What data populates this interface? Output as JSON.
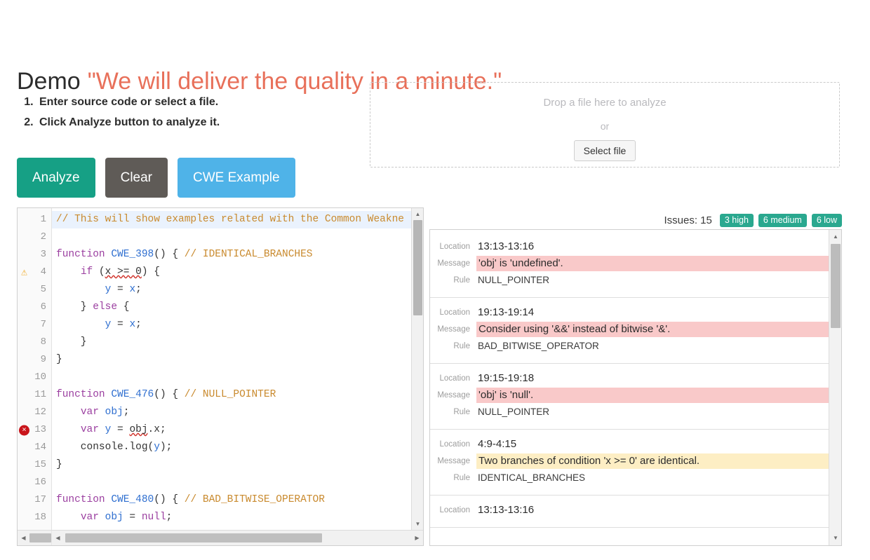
{
  "header": {
    "demo_word": "Demo",
    "tagline": "\"We will deliver the quality in a minute.\""
  },
  "instructions": [
    "Enter source code or select a file.",
    "Click Analyze button to analyze it."
  ],
  "buttons": {
    "analyze": "Analyze",
    "clear": "Clear",
    "cwe_example": "CWE Example"
  },
  "dropzone": {
    "title": "Drop a file here to analyze",
    "or": "or",
    "select_file": "Select file"
  },
  "editor": {
    "lines": [
      {
        "n": "1",
        "marker": "",
        "active": true,
        "tokens": [
          {
            "t": "// This will show examples related with the Common Weakne",
            "c": "cmt"
          }
        ]
      },
      {
        "n": "2",
        "marker": "",
        "active": false,
        "tokens": []
      },
      {
        "n": "3",
        "marker": "",
        "active": false,
        "tokens": [
          {
            "t": "function ",
            "c": "kw"
          },
          {
            "t": "CWE_398",
            "c": "fn"
          },
          {
            "t": "() { ",
            "c": "plain"
          },
          {
            "t": "// IDENTICAL_BRANCHES",
            "c": "cmt"
          }
        ]
      },
      {
        "n": "4",
        "marker": "warning",
        "active": false,
        "tokens": [
          {
            "t": "    ",
            "c": "plain"
          },
          {
            "t": "if",
            "c": "kw"
          },
          {
            "t": " (",
            "c": "plain"
          },
          {
            "t": "x >= 0",
            "c": "squig"
          },
          {
            "t": ") {",
            "c": "plain"
          }
        ]
      },
      {
        "n": "5",
        "marker": "",
        "active": false,
        "tokens": [
          {
            "t": "        ",
            "c": "plain"
          },
          {
            "t": "y",
            "c": "var"
          },
          {
            "t": " = ",
            "c": "plain"
          },
          {
            "t": "x",
            "c": "var"
          },
          {
            "t": ";",
            "c": "plain"
          }
        ]
      },
      {
        "n": "6",
        "marker": "",
        "active": false,
        "tokens": [
          {
            "t": "    } ",
            "c": "plain"
          },
          {
            "t": "else",
            "c": "kw"
          },
          {
            "t": " {",
            "c": "plain"
          }
        ]
      },
      {
        "n": "7",
        "marker": "",
        "active": false,
        "tokens": [
          {
            "t": "        ",
            "c": "plain"
          },
          {
            "t": "y",
            "c": "var"
          },
          {
            "t": " = ",
            "c": "plain"
          },
          {
            "t": "x",
            "c": "var"
          },
          {
            "t": ";",
            "c": "plain"
          }
        ]
      },
      {
        "n": "8",
        "marker": "",
        "active": false,
        "tokens": [
          {
            "t": "    }",
            "c": "plain"
          }
        ]
      },
      {
        "n": "9",
        "marker": "",
        "active": false,
        "tokens": [
          {
            "t": "}",
            "c": "plain"
          }
        ]
      },
      {
        "n": "10",
        "marker": "",
        "active": false,
        "tokens": []
      },
      {
        "n": "11",
        "marker": "",
        "active": false,
        "tokens": [
          {
            "t": "function ",
            "c": "kw"
          },
          {
            "t": "CWE_476",
            "c": "fn"
          },
          {
            "t": "() { ",
            "c": "plain"
          },
          {
            "t": "// NULL_POINTER",
            "c": "cmt"
          }
        ]
      },
      {
        "n": "12",
        "marker": "",
        "active": false,
        "tokens": [
          {
            "t": "    ",
            "c": "plain"
          },
          {
            "t": "var",
            "c": "kw"
          },
          {
            "t": " ",
            "c": "plain"
          },
          {
            "t": "obj",
            "c": "var"
          },
          {
            "t": ";",
            "c": "plain"
          }
        ]
      },
      {
        "n": "13",
        "marker": "error",
        "active": false,
        "tokens": [
          {
            "t": "    ",
            "c": "plain"
          },
          {
            "t": "var",
            "c": "kw"
          },
          {
            "t": " ",
            "c": "plain"
          },
          {
            "t": "y",
            "c": "var"
          },
          {
            "t": " = ",
            "c": "plain"
          },
          {
            "t": "obj",
            "c": "squig"
          },
          {
            "t": ".x;",
            "c": "plain"
          }
        ]
      },
      {
        "n": "14",
        "marker": "",
        "active": false,
        "tokens": [
          {
            "t": "    console.log(",
            "c": "plain"
          },
          {
            "t": "y",
            "c": "var"
          },
          {
            "t": ");",
            "c": "plain"
          }
        ]
      },
      {
        "n": "15",
        "marker": "",
        "active": false,
        "tokens": [
          {
            "t": "}",
            "c": "plain"
          }
        ]
      },
      {
        "n": "16",
        "marker": "",
        "active": false,
        "tokens": []
      },
      {
        "n": "17",
        "marker": "",
        "active": false,
        "tokens": [
          {
            "t": "function ",
            "c": "kw"
          },
          {
            "t": "CWE_480",
            "c": "fn"
          },
          {
            "t": "() { ",
            "c": "plain"
          },
          {
            "t": "// BAD_BITWISE_OPERATOR",
            "c": "cmt"
          }
        ]
      },
      {
        "n": "18",
        "marker": "",
        "active": false,
        "tokens": [
          {
            "t": "    ",
            "c": "plain"
          },
          {
            "t": "var",
            "c": "kw"
          },
          {
            "t": " ",
            "c": "plain"
          },
          {
            "t": "obj",
            "c": "var"
          },
          {
            "t": " = ",
            "c": "plain"
          },
          {
            "t": "null",
            "c": "kw"
          },
          {
            "t": ";",
            "c": "plain"
          }
        ]
      }
    ]
  },
  "issues": {
    "count_label": "Issues: 15",
    "badges": [
      {
        "label": "3 high",
        "color": "#2aa88f"
      },
      {
        "label": "6 medium",
        "color": "#2aa88f"
      },
      {
        "label": "6 low",
        "color": "#2aa88f"
      }
    ],
    "labels": {
      "location": "Location",
      "message": "Message",
      "rule": "Rule"
    },
    "items": [
      {
        "location": "13:13-13:16",
        "message": "'obj' is 'undefined'.",
        "severity": "high",
        "rule": "NULL_POINTER"
      },
      {
        "location": "19:13-19:14",
        "message": "Consider using '&&' instead of bitwise '&'.",
        "severity": "high",
        "rule": "BAD_BITWISE_OPERATOR"
      },
      {
        "location": "19:15-19:18",
        "message": "'obj' is 'null'.",
        "severity": "high",
        "rule": "NULL_POINTER"
      },
      {
        "location": "4:9-4:15",
        "message": "Two branches of condition 'x >= 0' are identical.",
        "severity": "medium",
        "rule": "IDENTICAL_BRANCHES"
      },
      {
        "location": "13:13-13:16",
        "message": "",
        "severity": "high",
        "rule": ""
      }
    ]
  }
}
